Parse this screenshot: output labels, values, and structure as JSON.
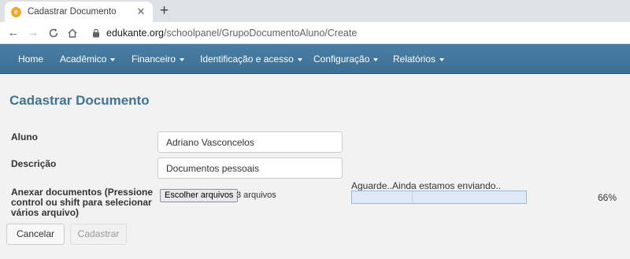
{
  "browser": {
    "tab_title": "Cadastrar Documento",
    "favicon_letter": "e",
    "close_glyph": "✕",
    "newtab_glyph": "+",
    "url_domain": "edukante.org",
    "url_path": "/schoolpanel/GrupoDocumentoAluno/Create"
  },
  "navbar": {
    "items": [
      {
        "label": "Home",
        "dropdown": false
      },
      {
        "label": "Acadêmico",
        "dropdown": true
      },
      {
        "label": "Financeiro",
        "dropdown": true
      },
      {
        "label": "Identificação e acesso",
        "dropdown": true
      },
      {
        "label": "Configuração",
        "dropdown": true
      },
      {
        "label": "Relatórios",
        "dropdown": true
      }
    ]
  },
  "page": {
    "title": "Cadastrar Documento"
  },
  "form": {
    "aluno_label": "Aluno",
    "aluno_value": "Adriano Vasconcelos",
    "descricao_label": "Descrição",
    "descricao_value": "Documentos pessoais",
    "anexar_label_1": "Anexar documentos (Pressione",
    "anexar_label_2": "control ou shift para selecionar",
    "anexar_label_3": "vários arquivo)",
    "file_button": "Escolher arquivos",
    "file_count": "3 arquivos"
  },
  "upload": {
    "status": "Aguarde..Ainda estamos enviando..",
    "percent_label": "66%",
    "percent_value": 0.35
  },
  "buttons": {
    "cancel": "Cancelar",
    "save": "Cadastrar"
  },
  "colors": {
    "navbar": "#3c6f93",
    "title": "#3f7494",
    "background": "#f2f2f2"
  }
}
